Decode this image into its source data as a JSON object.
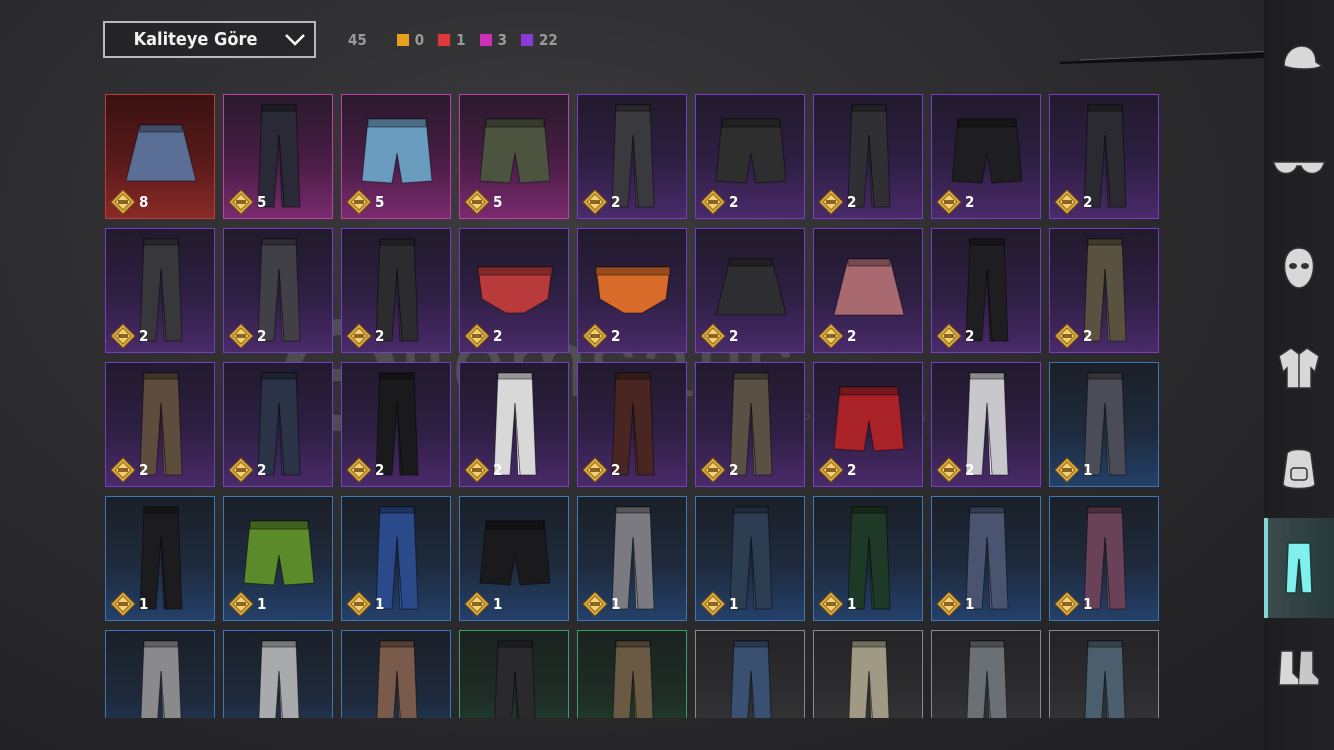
{
  "sort": {
    "label": "Kaliteye Göre"
  },
  "counts": {
    "total": "45",
    "qualities": [
      {
        "color": "#e8a020",
        "value": "0"
      },
      {
        "color": "#e03838",
        "value": "1"
      },
      {
        "color": "#d030b8",
        "value": "3"
      },
      {
        "color": "#8a3ad8",
        "value": "22"
      }
    ]
  },
  "watermark": {
    "brand": "itemsatis",
    "tagline": "HESAP / SKIN / ITEM / E-PIN",
    "tld": ".com"
  },
  "sidebar": {
    "categories": [
      {
        "name": "hat",
        "active": false
      },
      {
        "name": "glasses",
        "active": false
      },
      {
        "name": "mask",
        "active": false
      },
      {
        "name": "jacket",
        "active": false
      },
      {
        "name": "backpack",
        "active": false
      },
      {
        "name": "pants",
        "active": true
      },
      {
        "name": "shoes",
        "active": false
      }
    ]
  },
  "items": [
    {
      "r": "red",
      "t": "skirt",
      "c": "#5a6e96",
      "n": "8"
    },
    {
      "r": "pink",
      "t": "pants",
      "c": "#2a2a36",
      "n": "5"
    },
    {
      "r": "pink",
      "t": "shorts",
      "c": "#6a9cc0",
      "n": "5"
    },
    {
      "r": "pink",
      "t": "shorts",
      "c": "#4c5440",
      "n": "5"
    },
    {
      "r": "purple",
      "t": "pants",
      "c": "#3a3a3e",
      "n": "2"
    },
    {
      "r": "purple",
      "t": "shorts",
      "c": "#2e2e2e",
      "n": "2"
    },
    {
      "r": "purple",
      "t": "pants",
      "c": "#303034",
      "n": "2"
    },
    {
      "r": "purple",
      "t": "shorts",
      "c": "#1e1e20",
      "n": "2"
    },
    {
      "r": "purple",
      "t": "pants",
      "c": "#2a2a30",
      "n": "2"
    },
    {
      "r": "purple",
      "t": "pants",
      "c": "#38383c",
      "n": "2"
    },
    {
      "r": "purple",
      "t": "pants",
      "c": "#404046",
      "n": "2"
    },
    {
      "r": "purple",
      "t": "pants",
      "c": "#2c2c2e",
      "n": "2"
    },
    {
      "r": "purple",
      "t": "briefs",
      "c": "#b83a3a",
      "n": "2"
    },
    {
      "r": "purple",
      "t": "briefs",
      "c": "#d86a2a",
      "n": "2"
    },
    {
      "r": "purple",
      "t": "skirt",
      "c": "#2e2e30",
      "n": "2"
    },
    {
      "r": "purple",
      "t": "skirt",
      "c": "#a86a70",
      "n": "2"
    },
    {
      "r": "purple",
      "t": "pants",
      "c": "#1e1e20",
      "n": "2"
    },
    {
      "r": "purple",
      "t": "pants",
      "c": "#5a5240",
      "n": "2"
    },
    {
      "r": "purple",
      "t": "pants",
      "c": "#5e4c3c",
      "n": "2"
    },
    {
      "r": "purple",
      "t": "pants",
      "c": "#2a3446",
      "n": "2"
    },
    {
      "r": "purple",
      "t": "pants",
      "c": "#1a1a1c",
      "n": "2"
    },
    {
      "r": "purple",
      "t": "pants",
      "c": "#d8d8d8",
      "n": "2"
    },
    {
      "r": "purple",
      "t": "pants",
      "c": "#4a2622",
      "n": "2"
    },
    {
      "r": "purple",
      "t": "pants",
      "c": "#5a5044",
      "n": "2"
    },
    {
      "r": "purple",
      "t": "shorts",
      "c": "#a82228",
      "n": "2"
    },
    {
      "r": "purple",
      "t": "pants",
      "c": "#c8c8cc",
      "n": "2"
    },
    {
      "r": "blue",
      "t": "pants",
      "c": "#4a4c56",
      "n": "1"
    },
    {
      "r": "blue",
      "t": "pants",
      "c": "#1c1c1e",
      "n": "1"
    },
    {
      "r": "blue",
      "t": "shorts",
      "c": "#5a8a2a",
      "n": "1"
    },
    {
      "r": "blue",
      "t": "pants",
      "c": "#2a4a8a",
      "n": "1"
    },
    {
      "r": "blue",
      "t": "shorts",
      "c": "#1a1a1c",
      "n": "1"
    },
    {
      "r": "blue",
      "t": "pants",
      "c": "#7a7a80",
      "n": "1"
    },
    {
      "r": "blue",
      "t": "pants",
      "c": "#2e3e52",
      "n": "1"
    },
    {
      "r": "blue",
      "t": "pants",
      "c": "#1e3a26",
      "n": "1"
    },
    {
      "r": "blue",
      "t": "pants",
      "c": "#4a5470",
      "n": "1"
    },
    {
      "r": "blue",
      "t": "pants",
      "c": "#6a4258",
      "n": "1"
    },
    {
      "r": "blue",
      "t": "pants",
      "c": "#8a8a8c",
      "n": ""
    },
    {
      "r": "blue",
      "t": "pants",
      "c": "#a8aaac",
      "n": ""
    },
    {
      "r": "blue",
      "t": "pants",
      "c": "#7a5a4a",
      "n": ""
    },
    {
      "r": "green",
      "t": "pants",
      "c": "#2a2a2c",
      "n": ""
    },
    {
      "r": "green",
      "t": "pants",
      "c": "#6a5a44",
      "n": ""
    },
    {
      "r": "gray",
      "t": "pants",
      "c": "#3a5070",
      "n": ""
    },
    {
      "r": "gray",
      "t": "pants",
      "c": "#a09a84",
      "n": ""
    },
    {
      "r": "gray",
      "t": "pants",
      "c": "#6a7074",
      "n": ""
    },
    {
      "r": "gray",
      "t": "pants",
      "c": "#4a5e6e",
      "n": ""
    }
  ]
}
